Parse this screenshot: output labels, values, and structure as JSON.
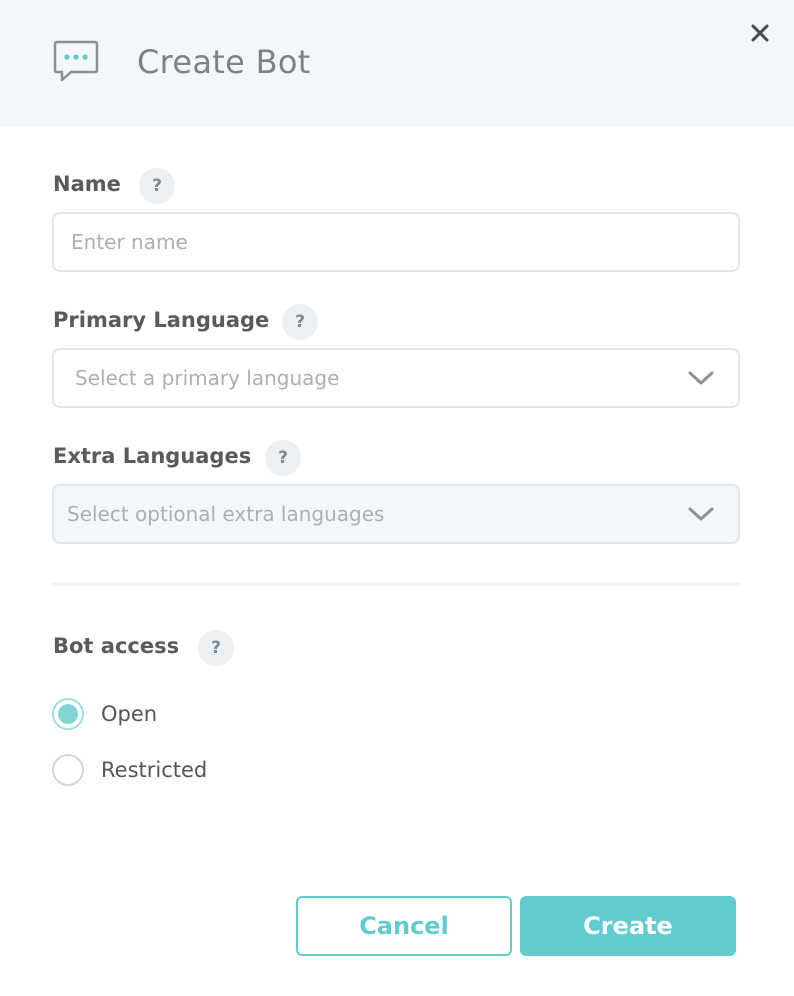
{
  "header": {
    "title": "Create Bot",
    "icon": "chat-bubble-icon",
    "close_label": "close"
  },
  "colors": {
    "accent": "#62cbd0",
    "header_bg": "#f3f7fa",
    "help_bg": "#ebf0f4"
  },
  "form": {
    "name": {
      "label": "Name",
      "help": "?",
      "placeholder": "Enter name",
      "value": ""
    },
    "primary_language": {
      "label": "Primary Language",
      "help": "?",
      "placeholder": "Select a primary language"
    },
    "extra_languages": {
      "label": "Extra Languages",
      "help": "?",
      "placeholder": "Select optional extra languages"
    },
    "bot_access": {
      "label": "Bot access",
      "help": "?",
      "options": [
        {
          "label": "Open",
          "checked": true
        },
        {
          "label": "Restricted",
          "checked": false
        }
      ]
    }
  },
  "footer": {
    "cancel_label": "Cancel",
    "create_label": "Create"
  }
}
